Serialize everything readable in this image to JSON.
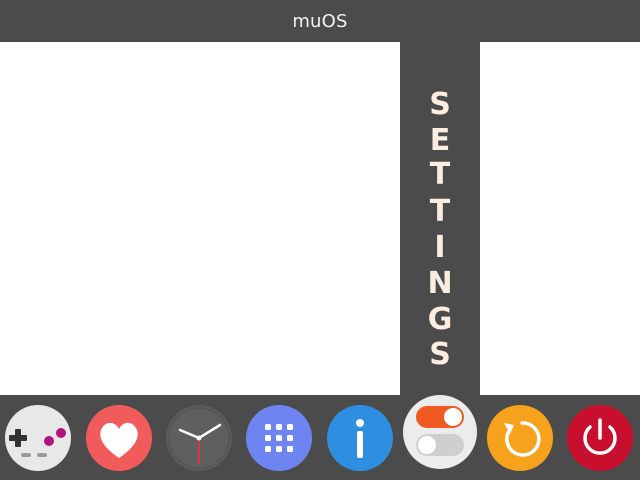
{
  "header": {
    "title": "muOS"
  },
  "section": {
    "label_letters": [
      "S",
      "E",
      "T",
      "T",
      "I",
      "N",
      "G",
      "S"
    ]
  },
  "dock": {
    "selected_index": 5,
    "items": [
      {
        "icon": "gamepad-icon",
        "color": "#e8e8e8"
      },
      {
        "icon": "heart-icon",
        "color": "#f25b5b"
      },
      {
        "icon": "clock-icon",
        "color": "#5b5b5b"
      },
      {
        "icon": "app-grid-icon",
        "color": "#6e84f0"
      },
      {
        "icon": "info-icon",
        "color": "#2e8fe0"
      },
      {
        "icon": "toggle-switches-icon",
        "color": "#ececec"
      },
      {
        "icon": "refresh-icon",
        "color": "#f7a21c"
      },
      {
        "icon": "power-icon",
        "color": "#c8102e"
      }
    ]
  },
  "colors": {
    "bar": "#4b4b4b",
    "background": "#ffffff",
    "label_text": "#fbeee0"
  }
}
